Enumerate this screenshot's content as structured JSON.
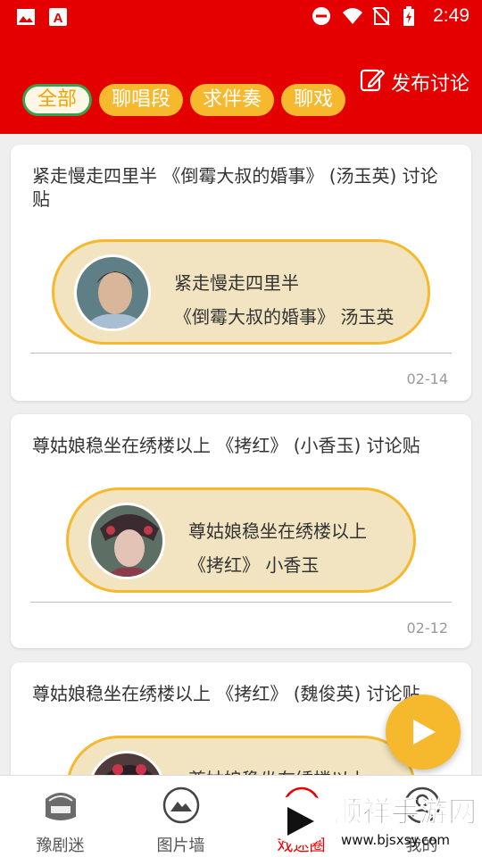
{
  "status_bar": {
    "time": "2:49",
    "left_icons": [
      "image-icon",
      "app-a-icon"
    ],
    "right_icons": [
      "dnd-icon",
      "wifi-icon",
      "no-sim-icon",
      "battery-icon"
    ]
  },
  "header": {
    "post_label": "发布讨论",
    "post_icon": "edit-icon",
    "tabs": [
      {
        "label": "全部",
        "active": true
      },
      {
        "label": "聊唱段",
        "active": false
      },
      {
        "label": "求伴奏",
        "active": false
      },
      {
        "label": "聊戏",
        "active": false
      }
    ]
  },
  "posts": [
    {
      "title": "紧走慢走四里半 《倒霉大叔的婚事》 (汤玉英) 讨论贴",
      "aria_line1": "紧走慢走四里半",
      "aria_line2": "《倒霉大叔的婚事》 汤玉英",
      "date": "02-14"
    },
    {
      "title": "尊姑娘稳坐在绣楼以上 《拷红》 (小香玉) 讨论贴",
      "aria_line1": "尊姑娘稳坐在绣楼以上",
      "aria_line2": "《拷红》 小香玉",
      "date": "02-12"
    },
    {
      "title": "尊姑娘稳坐在绣楼以上 《拷红》 (魏俊英) 讨论贴",
      "aria_line1": "尊姑娘稳坐在绣楼以上",
      "aria_line2": "",
      "date": ""
    }
  ],
  "fab": {
    "icon": "play-icon"
  },
  "bottom_nav": [
    {
      "label": "豫剧迷",
      "icon": "opera-logo-icon",
      "active": false
    },
    {
      "label": "图片墙",
      "icon": "picture-icon",
      "active": false
    },
    {
      "label": "戏迷圈",
      "icon": "circle-chat-icon",
      "active": true
    },
    {
      "label": "我的",
      "icon": "user-icon",
      "active": false
    }
  ],
  "watermark": {
    "title": "顺祥手游网",
    "url": "www.bjsxsy.com"
  },
  "colors": {
    "header_red": "#e50000",
    "accent_yellow": "#f6b82c",
    "pill_bg": "#f2e4c1",
    "active_green": "#3aa04f"
  }
}
